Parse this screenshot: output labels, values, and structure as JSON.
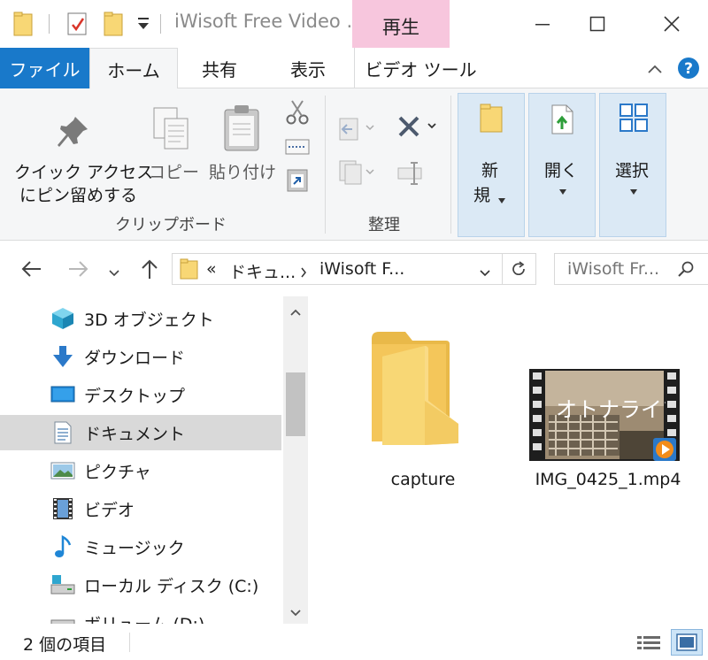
{
  "window": {
    "title": "iWisoft Free Video ...",
    "context_tab": "再生"
  },
  "ribbon_tabs": {
    "file": "ファイル",
    "home": "ホーム",
    "share": "共有",
    "view": "表示",
    "video_tools": "ビデオ ツール"
  },
  "ribbon": {
    "clipboard": {
      "pin_line1": "クイック アクセス",
      "pin_line2": "にピン留めする",
      "copy": "コピー",
      "paste": "貼り付け",
      "caption": "クリップボード"
    },
    "organize": {
      "caption": "整理"
    },
    "new": {
      "line1": "新",
      "line2": "規"
    },
    "open": "開く",
    "select": "選択"
  },
  "address": {
    "overflow": "«",
    "segment1": "ドキュ...",
    "segment2": "iWisoft F...",
    "search_placeholder": "iWisoft Fr..."
  },
  "nav_items": [
    {
      "label": "3D オブジェクト",
      "icon": "3d-objects-icon"
    },
    {
      "label": "ダウンロード",
      "icon": "download-icon"
    },
    {
      "label": "デスクトップ",
      "icon": "desktop-icon"
    },
    {
      "label": "ドキュメント",
      "icon": "documents-icon",
      "selected": true
    },
    {
      "label": "ピクチャ",
      "icon": "pictures-icon"
    },
    {
      "label": "ビデオ",
      "icon": "videos-icon"
    },
    {
      "label": "ミュージック",
      "icon": "music-icon"
    },
    {
      "label": "ローカル ディスク (C:)",
      "icon": "local-disk-icon"
    },
    {
      "label": "ボリューム (D:)",
      "icon": "volume-icon"
    }
  ],
  "files": [
    {
      "name": "capture",
      "type": "folder"
    },
    {
      "name": "IMG_0425_1.mp4",
      "type": "video",
      "thumbnail_text": "オトナライフ"
    }
  ],
  "status": {
    "item_count": "2 個の項目"
  },
  "colors": {
    "file_tab": "#1979ca",
    "context_tab": "#f7c6dd",
    "selection": "#d9d9d9",
    "ribbon_bg": "#f5f6f7",
    "folder": "#f8d775",
    "help": "#1979ca"
  }
}
